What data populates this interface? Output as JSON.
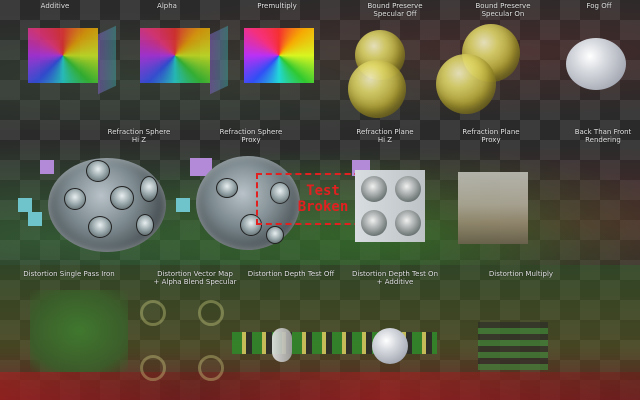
{
  "labels": {
    "additive": "Additive",
    "alpha": "Alpha",
    "premultiply": "Premultiply",
    "bound_preserve_off": "Bound Preserve\nSpecular Off",
    "bound_preserve_on": "Bound Preserve\nSpecular On",
    "fog_off": "Fog Off",
    "refraction_sphere_hiz": "Refraction Sphere\nHi Z",
    "refraction_sphere_proxy": "Refraction Sphere\nProxy",
    "refraction_plane_hiz": "Refraction Plane\nHi Z",
    "refraction_plane_proxy": "Refraction Plane\nProxy",
    "back_then_front": "Back Than Front\nRendering",
    "distortion_single_pass": "Distortion Single Pass Iron",
    "distortion_vector_map": "Distortion Vector Map\n+ Alpha Blend Specular",
    "distortion_depth_test_off": "Distortion Depth Test Off",
    "distortion_depth_test_on": "Distortion Depth Test On\n+ Additive",
    "distortion_multiply": "Distortion Multiply"
  },
  "broken": {
    "line1": "Test",
    "line2": "Broken"
  },
  "colors": {
    "broken_red": "#e22020",
    "label_text": "#e6e6e6"
  }
}
